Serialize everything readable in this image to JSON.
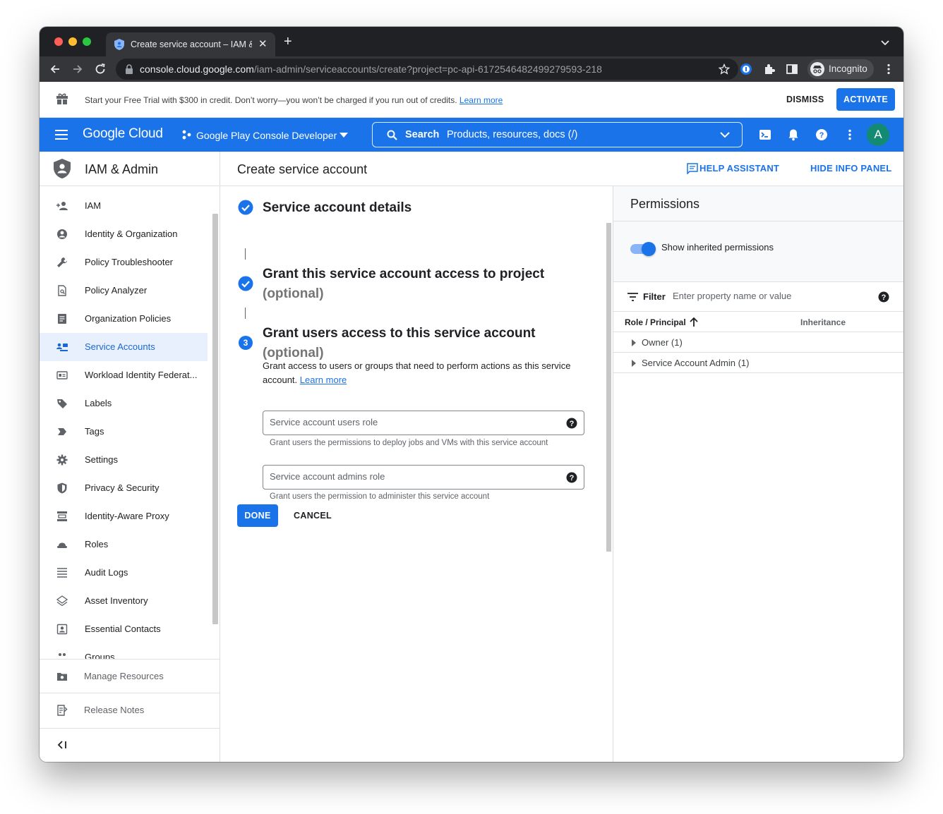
{
  "browser": {
    "tab_title": "Create service account – IAM & Admin",
    "url_host": "console.cloud.google.com",
    "url_path": "/iam-admin/serviceaccounts/create?project=pc-api-6172546482499279593-218",
    "incognito_label": "Incognito"
  },
  "banner": {
    "text": "Start your Free Trial with $300 in credit. Don’t worry—you won’t be charged if you run out of credits.",
    "learn_more": "Learn more",
    "dismiss": "DISMISS",
    "activate": "ACTIVATE"
  },
  "header": {
    "logo": "Google Cloud",
    "project": "Google Play Console Developer",
    "search_label": "Search",
    "search_placeholder": "Products, resources, docs (/)",
    "avatar_letter": "A"
  },
  "sidebar": {
    "title": "IAM & Admin",
    "items": [
      {
        "label": "IAM",
        "icon": "person-add-icon"
      },
      {
        "label": "Identity & Organization",
        "icon": "account-circle-icon"
      },
      {
        "label": "Policy Troubleshooter",
        "icon": "wrench-icon"
      },
      {
        "label": "Policy Analyzer",
        "icon": "doc-search-icon"
      },
      {
        "label": "Organization Policies",
        "icon": "list-doc-icon"
      },
      {
        "label": "Service Accounts",
        "icon": "service-account-icon",
        "active": true
      },
      {
        "label": "Workload Identity Federat...",
        "icon": "id-card-icon"
      },
      {
        "label": "Labels",
        "icon": "label-icon"
      },
      {
        "label": "Tags",
        "icon": "tag-icon"
      },
      {
        "label": "Settings",
        "icon": "gear-icon"
      },
      {
        "label": "Privacy & Security",
        "icon": "shield-icon"
      },
      {
        "label": "Identity-Aware Proxy",
        "icon": "proxy-icon"
      },
      {
        "label": "Roles",
        "icon": "roles-hat-icon"
      },
      {
        "label": "Audit Logs",
        "icon": "lines-icon"
      },
      {
        "label": "Asset Inventory",
        "icon": "layers-icon"
      },
      {
        "label": "Essential Contacts",
        "icon": "contact-icon"
      },
      {
        "label": "Groups",
        "icon": "groups-icon"
      }
    ],
    "manage_resources": "Manage Resources",
    "release_notes": "Release Notes"
  },
  "main": {
    "title": "Create service account",
    "help_assistant": "HELP ASSISTANT",
    "hide_info_panel": "HIDE INFO PANEL",
    "step1_title": "Service account details",
    "step2_title": "Grant this service account access to project",
    "step2_optional": "(optional)",
    "step3_number": "3",
    "step3_title": "Grant users access to this service account",
    "step3_optional": "(optional)",
    "step3_desc": "Grant access to users or groups that need to perform actions as this service account.",
    "learn_more": "Learn more",
    "users_role_placeholder": "Service account users role",
    "users_role_hint": "Grant users the permissions to deploy jobs and VMs with this service account",
    "admins_role_placeholder": "Service account admins role",
    "admins_role_hint": "Grant users the permission to administer this service account",
    "done": "DONE",
    "cancel": "CANCEL"
  },
  "info_panel": {
    "title": "Permissions",
    "toggle_label": "Show inherited permissions",
    "filter_label": "Filter",
    "filter_placeholder": "Enter property name or value",
    "col_role": "Role / Principal",
    "col_inheritance": "Inheritance",
    "rows": [
      {
        "label": "Owner (1)"
      },
      {
        "label": "Service Account Admin (1)"
      }
    ]
  },
  "colors": {
    "brand_blue": "#1a73e8",
    "active_bg": "#e8f0fe"
  }
}
